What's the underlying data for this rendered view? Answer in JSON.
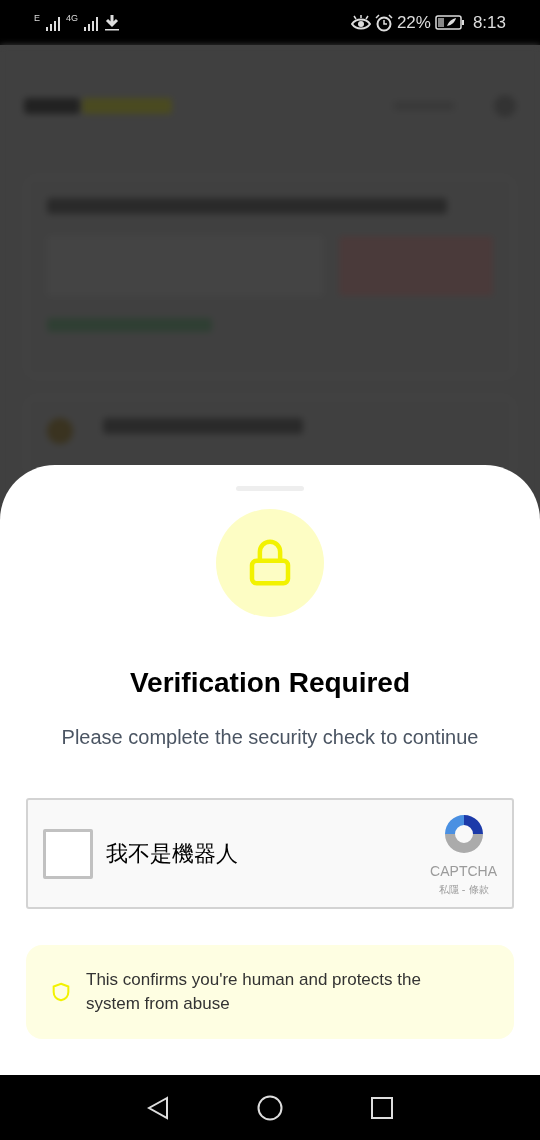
{
  "status_bar": {
    "network_1": "E",
    "network_2": "4G",
    "battery": "22%",
    "time": "8:13"
  },
  "dialog": {
    "title": "Verification Required",
    "subtitle": "Please complete the security check to continue",
    "captcha": {
      "label": "我不是機器人",
      "checked": false,
      "brand": "CAPTCHA",
      "links": "私隱 - 條款"
    },
    "notice": "This confirms you're human and protects the system from abuse"
  }
}
